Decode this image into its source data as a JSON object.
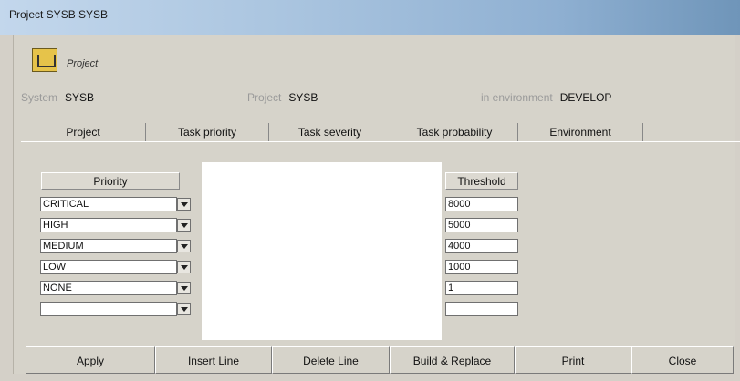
{
  "window": {
    "title": "Project SYSB SYSB"
  },
  "header": {
    "caption": "Project",
    "system_label": "System",
    "system_value": "SYSB",
    "project_label": "Project",
    "project_value": "SYSB",
    "env_label": "in environment",
    "env_value": "DEVELOP"
  },
  "tabs": [
    {
      "label": "Project"
    },
    {
      "label": "Task priority"
    },
    {
      "label": "Task severity"
    },
    {
      "label": "Task probability"
    },
    {
      "label": "Environment"
    }
  ],
  "table": {
    "priority_header": "Priority",
    "threshold_header": "Threshold",
    "rows": [
      {
        "priority": "CRITICAL",
        "threshold": "8000"
      },
      {
        "priority": "HIGH",
        "threshold": "5000"
      },
      {
        "priority": "MEDIUM",
        "threshold": "4000"
      },
      {
        "priority": "LOW",
        "threshold": "1000"
      },
      {
        "priority": "NONE",
        "threshold": "1"
      },
      {
        "priority": "",
        "threshold": ""
      }
    ]
  },
  "buttons": {
    "apply": "Apply",
    "insert_line": "Insert Line",
    "delete_line": "Delete Line",
    "build_replace": "Build & Replace",
    "print": "Print",
    "close": "Close"
  }
}
